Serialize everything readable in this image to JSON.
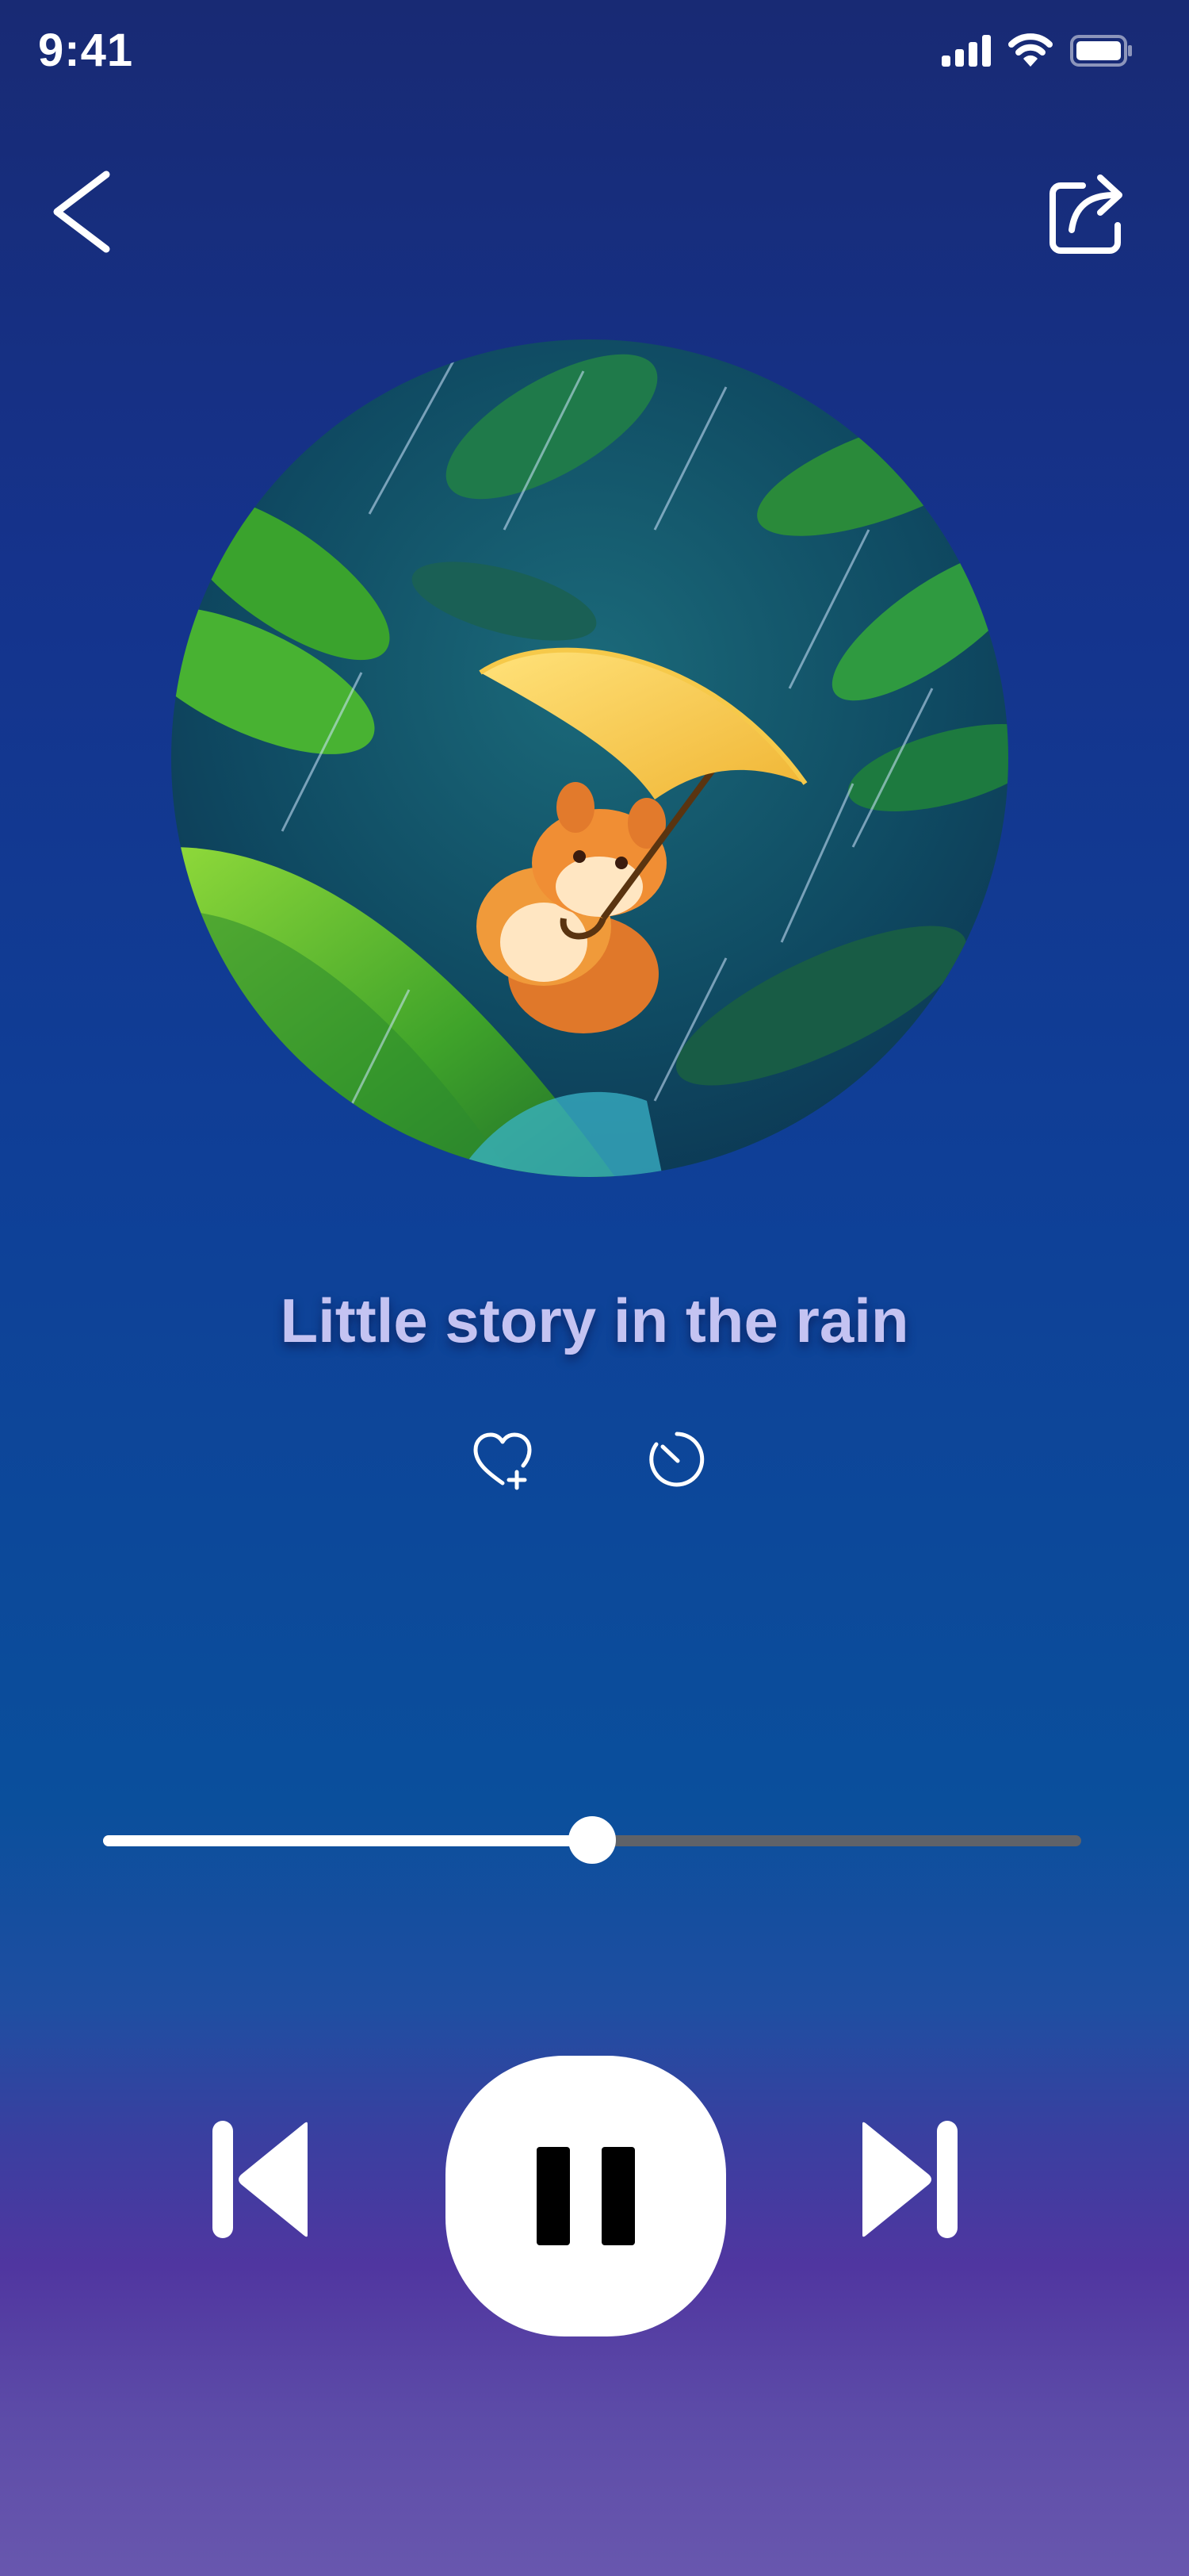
{
  "status_bar": {
    "time": "9:41",
    "icons": [
      "cellular-signal-icon",
      "wifi-icon",
      "battery-icon"
    ]
  },
  "nav": {
    "back_icon": "chevron-left-icon",
    "share_icon": "share-icon"
  },
  "artwork": {
    "description_icon": "album-artwork"
  },
  "track": {
    "title": "Little story in the rain"
  },
  "actions": {
    "favorite_icon": "heart-add-icon",
    "timer_icon": "sleep-timer-icon"
  },
  "playback": {
    "progress_fraction": 0.5,
    "state": "playing",
    "previous_icon": "skip-previous-icon",
    "pause_icon": "pause-icon",
    "next_icon": "skip-next-icon"
  },
  "colors": {
    "title_color": "#c4c3f2",
    "progress_filled": "#ffffff",
    "progress_remaining": "#5f6268",
    "bg_top": "#182a74",
    "bg_bottom": "#6857ae"
  }
}
